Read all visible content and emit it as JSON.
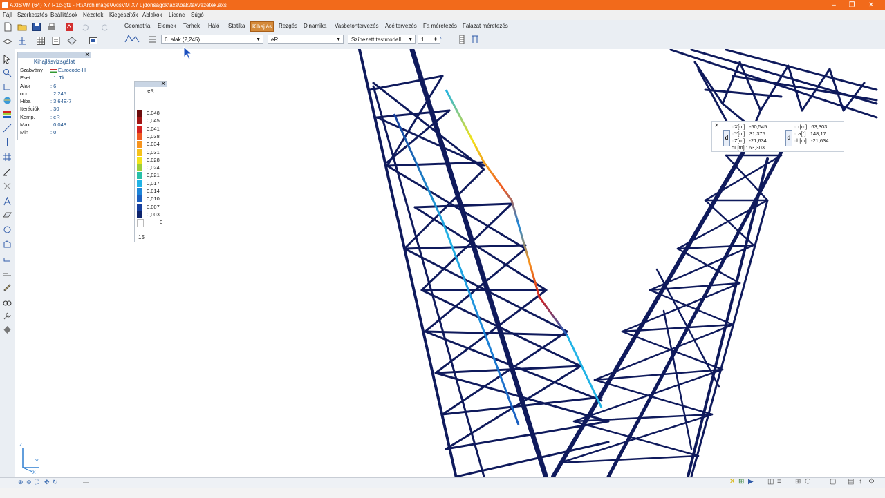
{
  "window": {
    "title": "AXISVM (64) X7 R1c-gf1 - H:\\Archimage\\AxisVM X7 újdonságok\\axs\\bak\\távvezeték.axs",
    "controls": [
      "–",
      "❐",
      "✕"
    ]
  },
  "menu": [
    "Fájl",
    "Szerkesztés",
    "Beállítások",
    "Nézetek",
    "Kiegészítők",
    "Ablakok",
    "Licenc",
    "Súgó"
  ],
  "ribbon_tabs": [
    "Geometria",
    "Elemek",
    "Terhek",
    "Háló",
    "Statika",
    "Kihajlás",
    "Rezgés",
    "Dinamika",
    "Vasbetontervezés",
    "Acéltervezés",
    "Fa méretezés",
    "Falazat méretezés"
  ],
  "active_tab": "Kihajlás",
  "controls": {
    "mode_select": "6. alak (2,245)",
    "component_select": "eR",
    "display_select": "Színezett testmodell",
    "scale_value": "1"
  },
  "info_panel": {
    "title": "Kihajlásvizsgálat",
    "rows": [
      {
        "key": "Szabvány",
        "value": "Eurocode-H"
      },
      {
        "key": "Eset",
        "value": ": 1. Tk"
      },
      {
        "key": "Alak",
        "value": ": 6"
      },
      {
        "key": "αcr",
        "value": ": 2,245"
      },
      {
        "key": "Hiba",
        "value": ": 3,64E-7"
      },
      {
        "key": "Iterációk",
        "value": ": 30"
      },
      {
        "key": "Komp.",
        "value": ": eR"
      },
      {
        "key": "Max",
        "value": ": 0,048"
      },
      {
        "key": "Min",
        "value": ": 0"
      }
    ]
  },
  "legend": {
    "component": "eR",
    "levels": [
      {
        "value": "0,048",
        "color": "#6b0c0c"
      },
      {
        "value": "0,045",
        "color": "#a31515"
      },
      {
        "value": "0,041",
        "color": "#d42222"
      },
      {
        "value": "0,038",
        "color": "#ef5a22"
      },
      {
        "value": "0,034",
        "color": "#f7941d"
      },
      {
        "value": "0,031",
        "color": "#f6c21a"
      },
      {
        "value": "0,028",
        "color": "#f2e31b"
      },
      {
        "value": "0,024",
        "color": "#9ccf3a"
      },
      {
        "value": "0,021",
        "color": "#27c0a9"
      },
      {
        "value": "0,017",
        "color": "#21b3e6"
      },
      {
        "value": "0,014",
        "color": "#1d86d9"
      },
      {
        "value": "0,010",
        "color": "#1b5fc0"
      },
      {
        "value": "0,007",
        "color": "#163f9e"
      },
      {
        "value": "0,003",
        "color": "#0d246d"
      },
      {
        "value": "0",
        "color": "#ffffff"
      }
    ],
    "count": "15"
  },
  "coords": {
    "left": [
      "dX[m] : -50,545",
      "dY[m] : 31,375",
      "dZ[m] : -21,634",
      "dL[m] : 63,303"
    ],
    "right": [
      "d r[m] : 63,303",
      "d a[°] : 148,17",
      "dh[m] : -21,634"
    ],
    "tag": "d"
  },
  "axes": {
    "z": "Z",
    "y": "Y",
    "x": "X"
  },
  "structure_color": "#0f1a5c"
}
